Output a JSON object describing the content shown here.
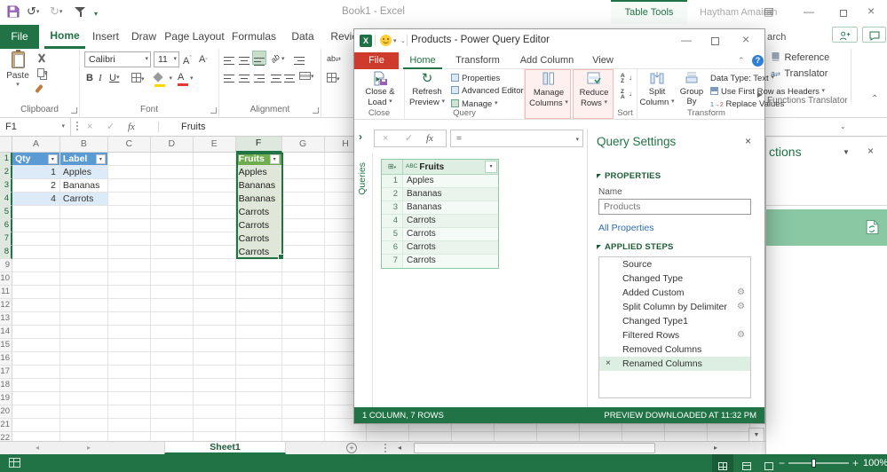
{
  "excel": {
    "titlebar": {
      "title": "Book1 - Excel",
      "contextual_tab": "Table Tools",
      "user": "Haytham Amairah"
    },
    "tabs": [
      "File",
      "Home",
      "Insert",
      "Draw",
      "Page Layout",
      "Formulas",
      "Data",
      "Review"
    ],
    "ribbon": {
      "paste": "Paste",
      "clipboard_group": "Clipboard",
      "font_group": "Font",
      "alignment_group": "Alignment",
      "font_name": "Calibri",
      "font_size": "11",
      "search_fragment": "arch",
      "reference": "Reference",
      "translator": "Translator",
      "functions_translator_group": "Functions Translator"
    },
    "formula_bar": {
      "name_box": "F1",
      "value": "Fruits"
    },
    "grid": {
      "columns": [
        "A",
        "B",
        "C",
        "D",
        "E",
        "F",
        "G",
        "H"
      ],
      "row_count": 22,
      "selected_column": "F",
      "selected_rows": [
        1,
        8
      ],
      "cells": [
        {
          "a": "A1",
          "v": "Qty",
          "cls": "th-blue filter"
        },
        {
          "a": "B1",
          "v": "Label",
          "cls": "th-blue filter"
        },
        {
          "a": "A2",
          "v": "1",
          "cls": "band num"
        },
        {
          "a": "B2",
          "v": "Apples",
          "cls": "band"
        },
        {
          "a": "A3",
          "v": "2",
          "cls": "num"
        },
        {
          "a": "B3",
          "v": "Bananas",
          "cls": ""
        },
        {
          "a": "A4",
          "v": "4",
          "cls": "band num"
        },
        {
          "a": "B4",
          "v": "Carrots",
          "cls": "band handle"
        },
        {
          "a": "F1",
          "v": "Fruits",
          "cls": "th-green filter"
        },
        {
          "a": "F2",
          "v": "Apples",
          "cls": "green"
        },
        {
          "a": "F3",
          "v": "Bananas",
          "cls": "green"
        },
        {
          "a": "F4",
          "v": "Bananas",
          "cls": "green"
        },
        {
          "a": "F5",
          "v": "Carrots",
          "cls": "green"
        },
        {
          "a": "F6",
          "v": "Carrots",
          "cls": "green"
        },
        {
          "a": "F7",
          "v": "Carrots",
          "cls": "green"
        },
        {
          "a": "F8",
          "v": "Carrots",
          "cls": "green"
        }
      ]
    },
    "sheet_tabs": {
      "active": "Sheet1"
    },
    "status_bar": {
      "zoom": "100%"
    },
    "colors": {
      "accent_green": "#217346",
      "table_blue": "#5b9bd5",
      "table_green": "#6fae4e"
    }
  },
  "queries_pane": {
    "title_fragment": "ctions"
  },
  "power_query": {
    "title": "Products - Power Query Editor",
    "tabs": [
      "File",
      "Home",
      "Transform",
      "Add Column",
      "View"
    ],
    "ribbon": {
      "close_load": "Close & Load",
      "refresh": "Refresh Preview",
      "properties": "Properties",
      "advanced_editor": "Advanced Editor",
      "manage": "Manage",
      "manage_columns": "Manage Columns",
      "reduce_rows": "Reduce Rows",
      "split_column": "Split Column",
      "group_by": "Group By",
      "data_type": "Data Type: Text",
      "first_row": "Use First Row as Headers",
      "replace_values": "Replace Values",
      "groups": {
        "close": "Close",
        "query": "Query",
        "sort": "Sort",
        "transform": "Transform"
      }
    },
    "queries_strip": "Queries",
    "formula": {
      "value": "="
    },
    "preview": {
      "type_label": "ABC",
      "column": "Fruits",
      "rows": [
        "Apples",
        "Bananas",
        "Bananas",
        "Carrots",
        "Carrots",
        "Carrots",
        "Carrots"
      ]
    },
    "settings": {
      "title": "Query Settings",
      "properties_label": "PROPERTIES",
      "name_label": "Name",
      "name_value": "Products",
      "all_properties": "All Properties",
      "applied_steps_label": "APPLIED STEPS",
      "steps": [
        {
          "label": "Source"
        },
        {
          "label": "Changed Type"
        },
        {
          "label": "Added Custom",
          "gear": true
        },
        {
          "label": "Split Column by Delimiter",
          "gear": true
        },
        {
          "label": "Changed Type1"
        },
        {
          "label": "Filtered Rows",
          "gear": true
        },
        {
          "label": "Removed Columns"
        },
        {
          "label": "Renamed Columns",
          "selected": true,
          "removable": true
        }
      ]
    },
    "status_bar": {
      "left": "1 COLUMN, 7 ROWS",
      "right": "PREVIEW DOWNLOADED AT 11:32 PM"
    }
  }
}
